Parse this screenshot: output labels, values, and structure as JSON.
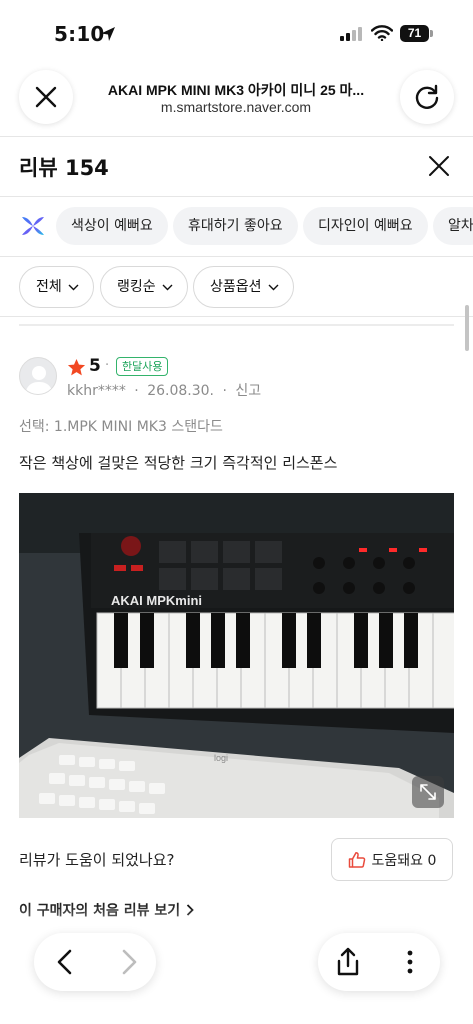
{
  "status_bar": {
    "time": "5:10",
    "battery": "71"
  },
  "browser": {
    "page_title": "AKAI MPK MINI MK3 아카이 미니 25 마...",
    "domain": "m.smartstore.naver.com"
  },
  "reviews": {
    "title": "리뷰 154",
    "keyword_chips": [
      "색상이 예뻐요",
      "휴대하기 좋아요",
      "디자인이 예뻐요",
      "알차"
    ],
    "filters": [
      "전체",
      "랭킹순",
      "상품옵션"
    ]
  },
  "review_item": {
    "rating": "5",
    "badge": "한달사용",
    "username": "kkhr****",
    "date": "26.08.30.",
    "report": "신고",
    "option": "선택: 1.MPK MINI MK3 스탠다드",
    "text": "작은 책상에 걸맞은 적당한 크기 즉각적인 리스폰스",
    "photo_brand": "AKAI MPKmini",
    "keyboard_brand": "logi",
    "helpful_question": "리뷰가 도움이 되었나요?",
    "helpful_label": "도움돼요 0",
    "first_review_link": "이 구매자의 처음 리뷰 보기"
  },
  "colors": {
    "star": "#f24822",
    "badge": "#1aa358",
    "helpful_icon": "#e94a3c"
  },
  "icons": [
    "location-arrow-icon",
    "signal-icon",
    "wifi-icon",
    "battery-icon",
    "close-icon",
    "reload-icon",
    "ai-icon",
    "chevron-down-icon",
    "star-icon",
    "expand-icon",
    "thumbs-up-icon",
    "chevron-right-icon",
    "back-icon",
    "forward-icon",
    "share-icon",
    "more-icon"
  ]
}
